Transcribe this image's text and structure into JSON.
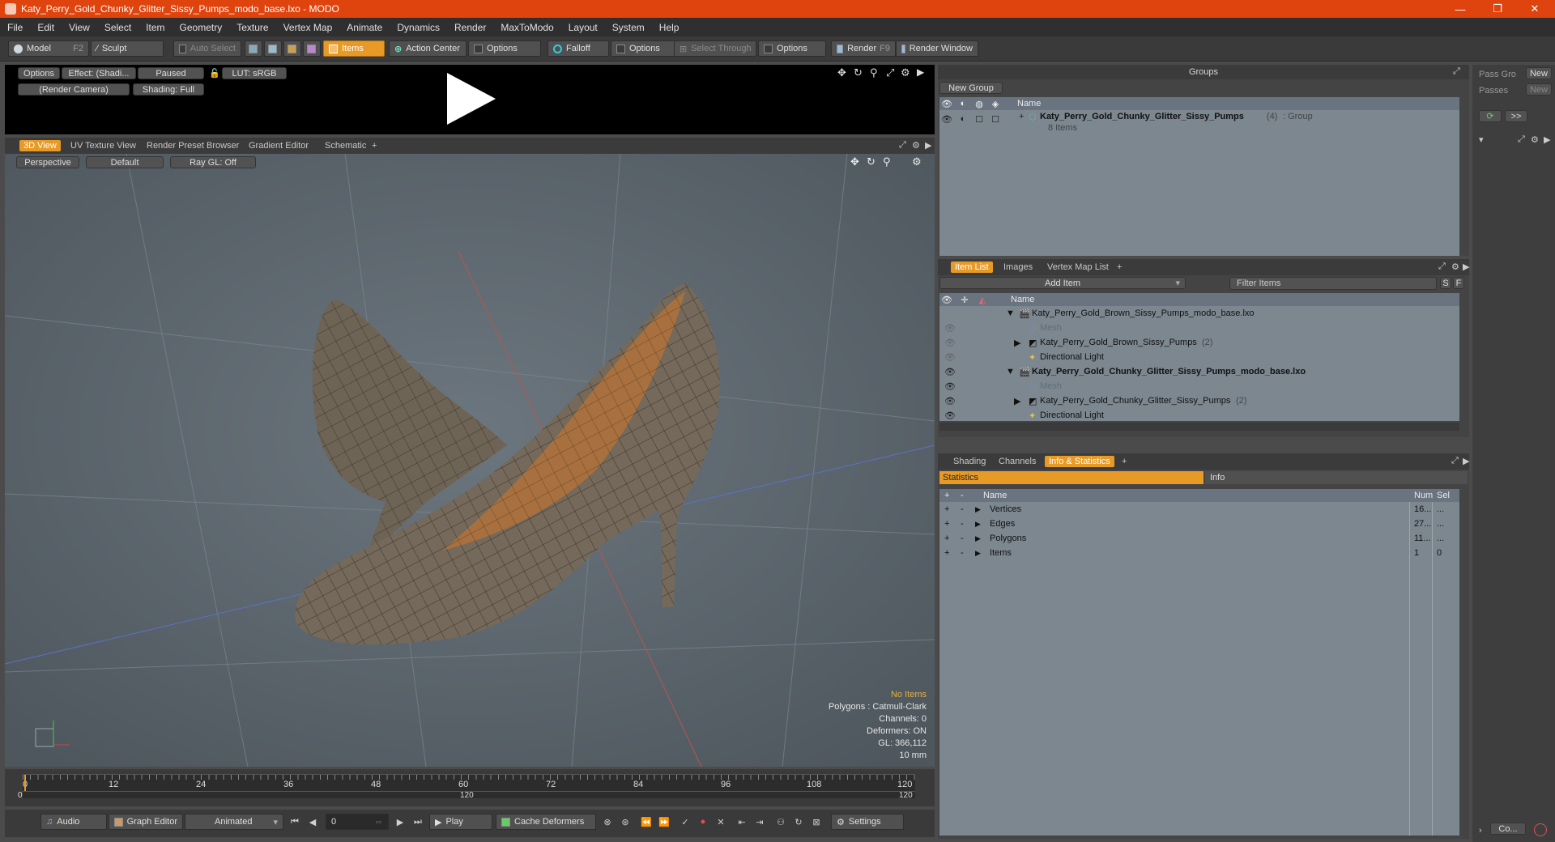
{
  "window": {
    "title": "Katy_Perry_Gold_Chunky_Glitter_Sissy_Pumps_modo_base.lxo - MODO",
    "min": "—",
    "max": "❐",
    "close": "✕"
  },
  "menu": [
    "File",
    "Edit",
    "View",
    "Select",
    "Item",
    "Geometry",
    "Texture",
    "Vertex Map",
    "Animate",
    "Dynamics",
    "Render",
    "MaxToModo",
    "Layout",
    "System",
    "Help"
  ],
  "toolbar": {
    "model": "Model",
    "model_key": "F2",
    "sculpt": "Sculpt",
    "auto_select": "Auto Select",
    "items": "Items",
    "action_center": "Action Center",
    "options1": "Options",
    "falloff": "Falloff",
    "options2": "Options",
    "select_through": "Select Through",
    "options3": "Options",
    "render": "Render",
    "render_key": "F9",
    "render_window": "Render Window"
  },
  "preview": {
    "options": "Options",
    "effect": "Effect: (Shadi...",
    "paused": "Paused",
    "lut": "LUT: sRGB",
    "camera": "(Render Camera)",
    "shading": "Shading: Full"
  },
  "viewport_tabs": [
    "3D View",
    "UV Texture View",
    "Render Preset Browser",
    "Gradient Editor",
    "Schematic",
    "+"
  ],
  "viewport": {
    "projection": "Perspective",
    "style": "Default",
    "raygl": "Ray GL: Off",
    "overlay": [
      "No Items",
      "Polygons : Catmull-Clark",
      "Channels: 0",
      "Deformers: ON",
      "GL: 366,112",
      "10 mm"
    ]
  },
  "timeline": {
    "ticks": [
      "0",
      "12",
      "24",
      "36",
      "48",
      "60",
      "72",
      "84",
      "96",
      "108",
      "120"
    ],
    "sub_ticks": [
      "0",
      "120",
      "120"
    ]
  },
  "bottom": {
    "audio": "Audio",
    "graph_editor": "Graph Editor",
    "animated": "Animated",
    "frame": "0",
    "play": "Play",
    "cache": "Cache Deformers",
    "settings": "Settings"
  },
  "groups": {
    "title": "Groups",
    "new_group": "New Group",
    "col_name": "Name",
    "item_name": "Katy_Perry_Gold_Chunky_Glitter_Sissy_Pumps",
    "item_count": "(4)",
    "item_type": ": Group",
    "item_sub": "8 Items"
  },
  "far_right": {
    "pass_groups": "Pass Gro",
    "new1": "New",
    "passes": "Passes",
    "new2": "New",
    "more": ">>",
    "co": "Co..."
  },
  "item_list": {
    "tabs": [
      "Item List",
      "Images",
      "Vertex Map List",
      "+"
    ],
    "add_item": "Add Item",
    "filter": "Filter Items",
    "s": "S",
    "f": "F",
    "col_name": "Name",
    "rows": [
      {
        "label": "Katy_Perry_Gold_Brown_Sissy_Pumps_modo_base.lxo",
        "bold": false
      },
      {
        "label": "Mesh",
        "bold": false
      },
      {
        "label": "Katy_Perry_Gold_Brown_Sissy_Pumps",
        "count": "(2)",
        "bold": false
      },
      {
        "label": "Directional Light",
        "bold": false
      },
      {
        "label": "Katy_Perry_Gold_Chunky_Glitter_Sissy_Pumps_modo_base.lxo",
        "bold": true
      },
      {
        "label": "Mesh",
        "bold": false
      },
      {
        "label": "Katy_Perry_Gold_Chunky_Glitter_Sissy_Pumps",
        "count": "(2)",
        "bold": false
      },
      {
        "label": "Directional Light",
        "bold": false
      }
    ]
  },
  "stats": {
    "tabs": [
      "Shading",
      "Channels",
      "Info & Statistics",
      "+"
    ],
    "sub_stats": "Statistics",
    "sub_info": "Info",
    "cols": {
      "name": "Name",
      "num": "Num",
      "sel": "Sel"
    },
    "rows": [
      {
        "name": "Vertices",
        "num": "16...",
        "sel": "..."
      },
      {
        "name": "Edges",
        "num": "27...",
        "sel": "..."
      },
      {
        "name": "Polygons",
        "num": "11...",
        "sel": "..."
      },
      {
        "name": "Items",
        "num": "1",
        "sel": "0"
      }
    ]
  },
  "colors": {
    "accent": "#e79a26",
    "title": "#e0440e"
  }
}
